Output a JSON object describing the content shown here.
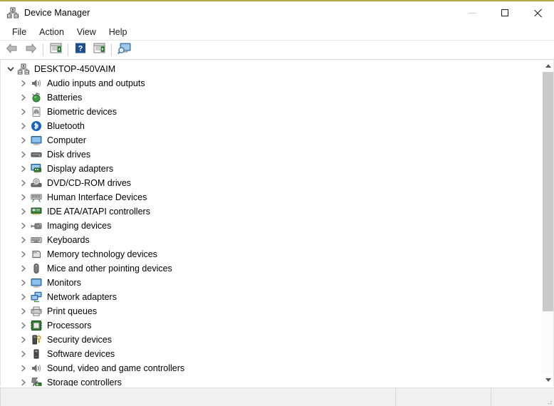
{
  "window": {
    "title": "Device Manager",
    "title_icon": "device-manager-icon",
    "accent_border": "#b5a642",
    "caption": {
      "minimize_label": "Minimize",
      "maximize_label": "Maximize",
      "close_label": "Close"
    }
  },
  "menubar": {
    "items": [
      {
        "label": "File",
        "name": "menu-file"
      },
      {
        "label": "Action",
        "name": "menu-action"
      },
      {
        "label": "View",
        "name": "menu-view"
      },
      {
        "label": "Help",
        "name": "menu-help"
      }
    ]
  },
  "toolbar": {
    "buttons": [
      {
        "icon": "back-arrow-icon",
        "label": "Back"
      },
      {
        "icon": "forward-arrow-icon",
        "label": "Forward"
      },
      {
        "icon": "show-hide-console-tree-icon",
        "label": "Show/hide console tree"
      },
      {
        "icon": "help-question-icon",
        "label": "Help"
      },
      {
        "icon": "properties-icon",
        "label": "Properties"
      },
      {
        "icon": "scan-for-hardware-changes-icon",
        "label": "Scan for hardware changes"
      }
    ]
  },
  "tree": {
    "root": {
      "label": "DESKTOP-450VAIM",
      "icon": "computer-tree-icon",
      "expanded": true,
      "chevron": "chevron-down-icon"
    },
    "children": [
      {
        "label": "Audio inputs and outputs",
        "icon": "speaker-icon",
        "chevron": "chevron-right-icon"
      },
      {
        "label": "Batteries",
        "icon": "battery-icon",
        "chevron": "chevron-right-icon"
      },
      {
        "label": "Biometric devices",
        "icon": "fingerprint-icon",
        "chevron": "chevron-right-icon"
      },
      {
        "label": "Bluetooth",
        "icon": "bluetooth-icon",
        "chevron": "chevron-right-icon"
      },
      {
        "label": "Computer",
        "icon": "monitor-icon",
        "chevron": "chevron-right-icon"
      },
      {
        "label": "Disk drives",
        "icon": "disk-drive-icon",
        "chevron": "chevron-right-icon"
      },
      {
        "label": "Display adapters",
        "icon": "display-adapter-icon",
        "chevron": "chevron-right-icon"
      },
      {
        "label": "DVD/CD-ROM drives",
        "icon": "optical-drive-icon",
        "chevron": "chevron-right-icon"
      },
      {
        "label": "Human Interface Devices",
        "icon": "hid-keyboard-icon",
        "chevron": "chevron-right-icon"
      },
      {
        "label": "IDE ATA/ATAPI controllers",
        "icon": "ide-controller-icon",
        "chevron": "chevron-right-icon"
      },
      {
        "label": "Imaging devices",
        "icon": "camera-icon",
        "chevron": "chevron-right-icon"
      },
      {
        "label": "Keyboards",
        "icon": "keyboard-icon",
        "chevron": "chevron-right-icon"
      },
      {
        "label": "Memory technology devices",
        "icon": "memory-card-icon",
        "chevron": "chevron-right-icon"
      },
      {
        "label": "Mice and other pointing devices",
        "icon": "mouse-icon",
        "chevron": "chevron-right-icon"
      },
      {
        "label": "Monitors",
        "icon": "monitor-icon",
        "chevron": "chevron-right-icon"
      },
      {
        "label": "Network adapters",
        "icon": "network-adapter-icon",
        "chevron": "chevron-right-icon"
      },
      {
        "label": "Print queues",
        "icon": "printer-icon",
        "chevron": "chevron-right-icon"
      },
      {
        "label": "Processors",
        "icon": "cpu-icon",
        "chevron": "chevron-right-icon"
      },
      {
        "label": "Security devices",
        "icon": "security-key-icon",
        "chevron": "chevron-right-icon"
      },
      {
        "label": "Software devices",
        "icon": "software-device-icon",
        "chevron": "chevron-right-icon"
      },
      {
        "label": "Sound, video and game controllers",
        "icon": "speaker-icon",
        "chevron": "chevron-right-icon"
      },
      {
        "label": "Storage controllers",
        "icon": "storage-controller-icon",
        "chevron": "chevron-right-icon"
      }
    ]
  },
  "scrollbar": {
    "up_icon": "scroll-up-arrow-icon",
    "down_icon": "scroll-down-arrow-icon",
    "thumb_name": "vertical-scroll-thumb"
  },
  "statusbar": {
    "pane1": "",
    "pane2": "",
    "pane3": ""
  }
}
